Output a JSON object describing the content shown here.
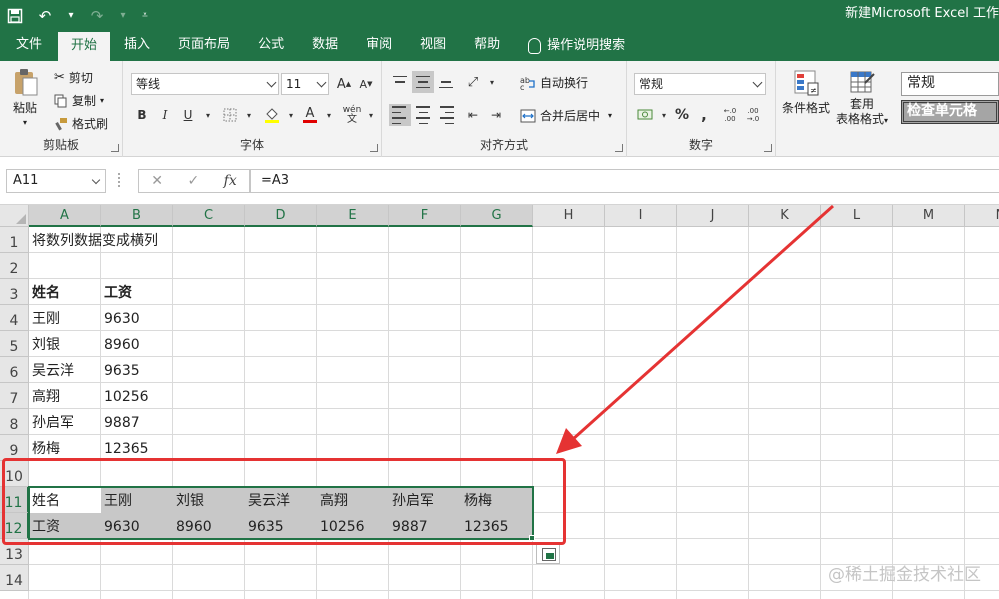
{
  "window": {
    "title": "新建Microsoft Excel 工作"
  },
  "tabs": [
    "文件",
    "开始",
    "插入",
    "页面布局",
    "公式",
    "数据",
    "审阅",
    "视图",
    "帮助"
  ],
  "tell_me": "操作说明搜索",
  "ribbon": {
    "clipboard": {
      "label": "剪贴板",
      "paste": "粘贴",
      "cut": "剪切",
      "copy": "复制",
      "format_painter": "格式刷"
    },
    "font": {
      "label": "字体",
      "name": "等线",
      "size": "11",
      "bold": "B",
      "italic": "I",
      "underline": "U",
      "phonetic": "wén",
      "grow": "A",
      "shrink": "A"
    },
    "alignment": {
      "label": "对齐方式",
      "wrap_text": "自动换行",
      "merge_center": "合并后居中"
    },
    "number": {
      "label": "数字",
      "format": "常规",
      "percent": "%",
      "comma": ","
    },
    "styles": {
      "conditional": "条件格式",
      "table_format_1": "套用",
      "table_format_2": "表格格式",
      "style_normal": "常规",
      "style_check": "检查单元格"
    }
  },
  "formula_bar": {
    "name_box": "A11",
    "cancel": "✕",
    "enter": "✓",
    "fx": "fx",
    "formula": "=A3"
  },
  "sheet": {
    "columns": [
      "A",
      "B",
      "C",
      "D",
      "E",
      "F",
      "G",
      "H",
      "I",
      "J",
      "K",
      "L",
      "M",
      "N"
    ],
    "rows": [
      "1",
      "2",
      "3",
      "4",
      "5",
      "6",
      "7",
      "8",
      "9",
      "10",
      "11",
      "12",
      "13",
      "14"
    ],
    "title": "将数列数据变成横列",
    "header": [
      "姓名",
      "工资"
    ],
    "names": [
      "王刚",
      "刘银",
      "吴云洋",
      "高翔",
      "孙启军",
      "杨梅"
    ],
    "salaries": [
      "9630",
      "8960",
      "9635",
      "10256",
      "9887",
      "12365"
    ],
    "transposed_row_11": [
      "姓名",
      "王刚",
      "刘银",
      "吴云洋",
      "高翔",
      "孙启军",
      "杨梅"
    ],
    "transposed_row_12": [
      "工资",
      "9630",
      "8960",
      "9635",
      "10256",
      "9887",
      "12365"
    ]
  },
  "annotation": {
    "arrow_color": "#e53333",
    "box_color": "#e53333"
  },
  "watermark": "@稀土掘金技术社区",
  "colors": {
    "accent": "#217346",
    "selection": "#c8c8c8"
  }
}
